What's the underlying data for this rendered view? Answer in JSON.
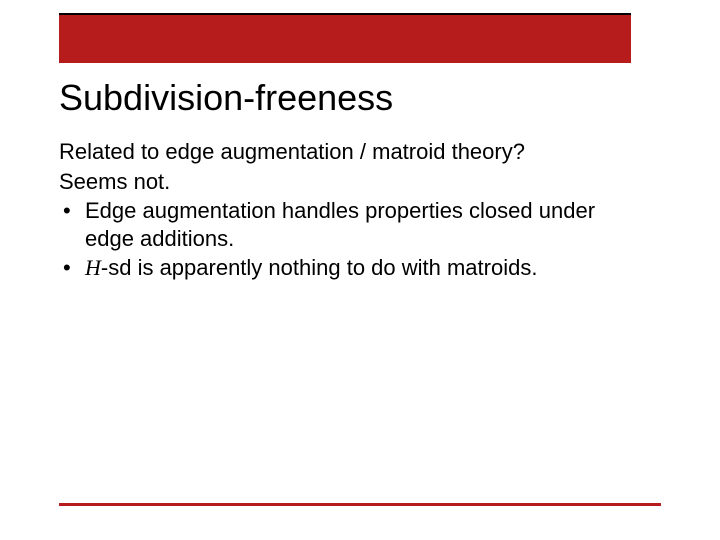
{
  "colors": {
    "accent_red": "#b71c1c",
    "top_border": "#000000"
  },
  "title": "Subdivision-freeness",
  "body": {
    "line1": "Related to edge augmentation / matroid theory?",
    "line2": "Seems not.",
    "bullets": [
      {
        "text": "Edge augmentation handles properties closed under edge additions."
      },
      {
        "prefix_italic": "H",
        "rest": "-sd is apparently nothing to do with matroids."
      }
    ]
  }
}
